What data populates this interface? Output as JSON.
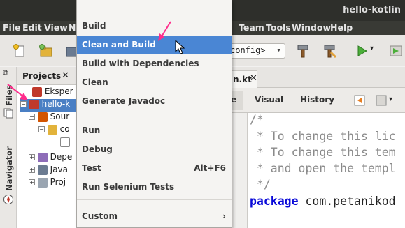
{
  "window": {
    "title": "hello-kotlin"
  },
  "menubar": {
    "items": [
      {
        "label": "File",
        "mnemonic": "F"
      },
      {
        "label": "Edit",
        "mnemonic": "E"
      },
      {
        "label": "View",
        "mnemonic": "V"
      },
      {
        "label": "N",
        "mnemonic": "N"
      },
      {
        "label": "Team",
        "mnemonic": ""
      },
      {
        "label": "Tools",
        "mnemonic": "T"
      },
      {
        "label": "Window",
        "mnemonic": "W"
      },
      {
        "label": "Help",
        "mnemonic": "H"
      }
    ]
  },
  "toolbar": {
    "config_select": "config>",
    "icons": [
      "new-file-icon",
      "new-project-icon",
      "open-project-icon",
      "build-icon",
      "clean-build-icon",
      "run-icon"
    ]
  },
  "dropdown": {
    "items": [
      {
        "label": "Build",
        "shortcut": "",
        "highlighted": false
      },
      {
        "label": "Clean and Build",
        "shortcut": "",
        "highlighted": true
      },
      {
        "label": "Build with Dependencies",
        "shortcut": "",
        "highlighted": false
      },
      {
        "label": "Clean",
        "shortcut": "",
        "highlighted": false
      },
      {
        "label": "Generate Javadoc",
        "shortcut": "",
        "highlighted": false
      },
      {
        "label": "Run",
        "shortcut": "",
        "highlighted": false
      },
      {
        "label": "Debug",
        "shortcut": "",
        "highlighted": false
      },
      {
        "label": "Test",
        "shortcut": "Alt+F6",
        "highlighted": false
      },
      {
        "label": "Run Selenium Tests",
        "shortcut": "",
        "highlighted": false
      },
      {
        "label": "Custom",
        "shortcut": "",
        "highlighted": false,
        "submenu": true
      }
    ]
  },
  "left_strip": {
    "files_label": "Files",
    "navigator_label": "Navigator"
  },
  "projects": {
    "tab_label": "Projects",
    "close": "✕",
    "tree": [
      {
        "label": "Eksper",
        "expander": "+",
        "selected": false
      },
      {
        "label": "hello-k",
        "expander": "−",
        "selected": true
      },
      {
        "label": "Sour",
        "expander": "−",
        "selected": false
      },
      {
        "label": "co",
        "expander": "−",
        "selected": false
      },
      {
        "label": "",
        "expander": "",
        "selected": false
      },
      {
        "label": "Depe",
        "expander": "+",
        "selected": false
      },
      {
        "label": "Java",
        "expander": "+",
        "selected": false
      },
      {
        "label": "Proj",
        "expander": "+",
        "selected": false
      }
    ]
  },
  "editor": {
    "file_tab": "n.kt",
    "file_tab_close": "✕",
    "tabs": [
      "e",
      "Visual",
      "History"
    ],
    "code_lines": [
      {
        "text": "/*",
        "kind": "comment"
      },
      {
        "text": " * To change this lic",
        "kind": "comment"
      },
      {
        "text": " * To change this tem",
        "kind": "comment"
      },
      {
        "text": " * and open the templ",
        "kind": "comment"
      },
      {
        "text": " */",
        "kind": "comment"
      }
    ],
    "package_keyword": "package",
    "package_name": " com.petanikod"
  },
  "colors": {
    "highlight": "#4a86d4",
    "selection": "#4a7fc4",
    "annotation_arrow": "#ff2d8c"
  }
}
